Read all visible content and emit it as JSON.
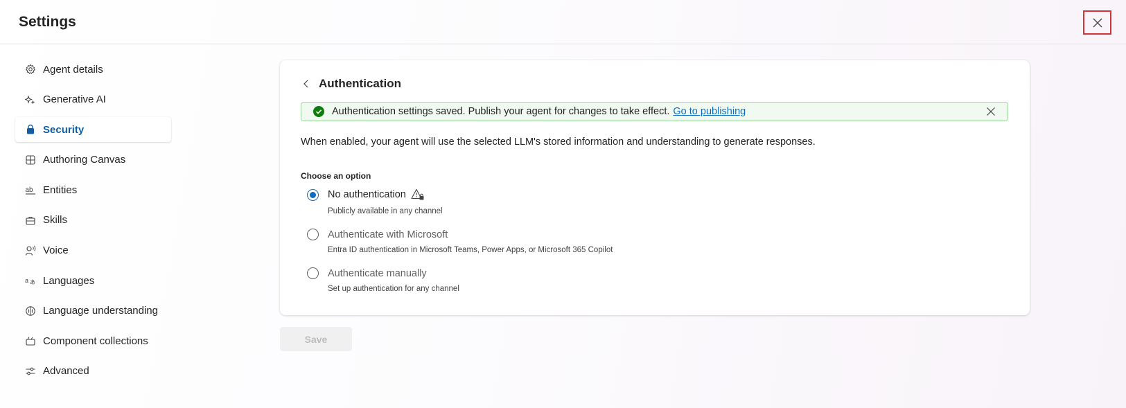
{
  "header": {
    "title": "Settings",
    "close_icon": "close-icon"
  },
  "sidebar": {
    "items": [
      {
        "label": "Agent details",
        "icon": "gear-icon"
      },
      {
        "label": "Generative AI",
        "icon": "sparkle-icon"
      },
      {
        "label": "Security",
        "icon": "lock-icon",
        "active": true
      },
      {
        "label": "Authoring Canvas",
        "icon": "grid-icon"
      },
      {
        "label": "Entities",
        "icon": "text-abc-icon"
      },
      {
        "label": "Skills",
        "icon": "briefcase-icon"
      },
      {
        "label": "Voice",
        "icon": "person-voice-icon"
      },
      {
        "label": "Languages",
        "icon": "translate-icon"
      },
      {
        "label": "Language understanding",
        "icon": "brain-icon"
      },
      {
        "label": "Component collections",
        "icon": "collection-icon"
      },
      {
        "label": "Advanced",
        "icon": "sliders-icon"
      }
    ]
  },
  "main": {
    "title": "Authentication",
    "banner": {
      "message": "Authentication settings saved. Publish your agent for changes to take effect.",
      "link": "Go to publishing"
    },
    "description": "When enabled, your agent will use the selected LLM's stored information and understanding to generate responses.",
    "choose_label": "Choose an option",
    "options": [
      {
        "label": "No authentication",
        "sub": "Publicly available in any channel",
        "selected": true
      },
      {
        "label": "Authenticate with Microsoft",
        "sub": "Entra ID authentication in Microsoft Teams, Power Apps, or Microsoft 365 Copilot",
        "selected": false
      },
      {
        "label": "Authenticate manually",
        "sub": "Set up authentication for any channel",
        "selected": false
      }
    ]
  },
  "actions": {
    "save_label": "Save"
  },
  "colors": {
    "accent": "#0f6cbd",
    "success": "#107c10",
    "close_highlight": "#d13438"
  }
}
